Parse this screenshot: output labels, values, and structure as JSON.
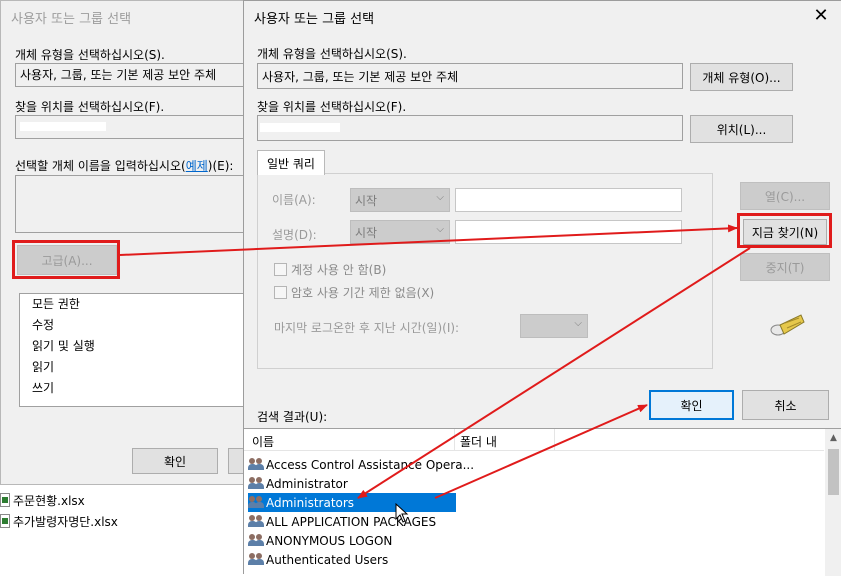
{
  "back_dialog": {
    "title": "사용자 또는 그룹 선택",
    "object_type_label": "개체 유형을 선택하십시오(S).",
    "object_type_value": "사용자, 그룹, 또는 기본 제공 보안 주체",
    "location_label": "찾을 위치를 선택하십시오(F).",
    "enter_names_label_pre": "선택할 개체 이름을 입력하십시오(",
    "enter_names_link": "예제",
    "enter_names_label_post": ")(E):",
    "advanced_button": "고급(A)...",
    "permissions": [
      "모든 권한",
      "수정",
      "읽기 및 실행",
      "읽기",
      "쓰기"
    ],
    "ok_button": "확인"
  },
  "explorer_files": [
    "주문현황.xlsx",
    "추가발령자명단.xlsx"
  ],
  "main_dialog": {
    "title": "사용자 또는 그룹 선택",
    "object_type_label": "개체 유형을 선택하십시오(S).",
    "object_type_value": "사용자, 그룹, 또는 기본 제공 보안 주체",
    "object_type_button": "개체 유형(O)...",
    "location_label": "찾을 위치를 선택하십시오(F).",
    "location_button": "위치(L)...",
    "tab_label": "일반 쿼리",
    "name_label": "이름(A):",
    "name_combo": "시작",
    "desc_label": "설명(D):",
    "desc_combo": "시작",
    "disabled_accounts": "계정 사용 안 함(B)",
    "non_expiring": "암호 사용 기간 제한 없음(X)",
    "days_since_logon": "마지막 로그온한 후 지난 시간(일)(I):",
    "columns_button": "열(C)...",
    "find_now_button": "지금 찾기(N)",
    "stop_button": "중지(T)",
    "ok_button": "확인",
    "cancel_button": "취소",
    "results_label": "검색 결과(U):",
    "col_name": "이름",
    "col_folder": "폴더 내",
    "results": [
      "Access Control Assistance Opera...",
      "Administrator",
      "Administrators",
      "ALL APPLICATION PACKAGES",
      "ANONYMOUS LOGON",
      "Authenticated Users"
    ],
    "selected_index": 2
  },
  "colors": {
    "highlight": "#e01b1b",
    "selection": "#0078d7"
  }
}
